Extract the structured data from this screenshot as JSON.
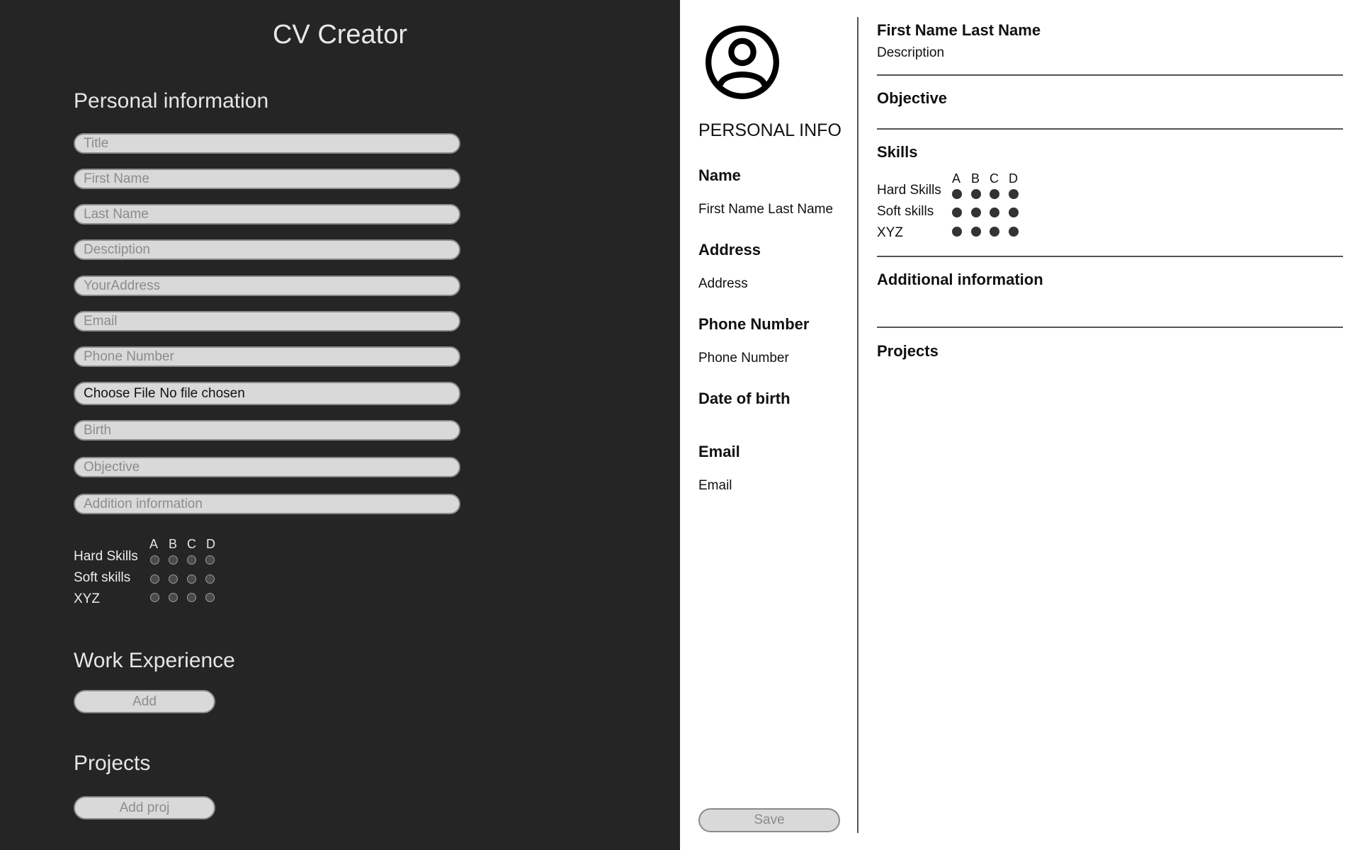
{
  "editor": {
    "app_title": "CV Creator",
    "personal_section_title": "Personal information",
    "fields": {
      "title": "Title",
      "first_name": "First Name",
      "last_name": "Last Name",
      "description": "Desctiption",
      "address": "YourAddress",
      "email": "Email",
      "phone": "Phone Number",
      "birth": "Birth",
      "objective": "Objective",
      "additional": "Addition information"
    },
    "file_input": {
      "button_label": "Choose File",
      "status": "No file chosen"
    },
    "skills": {
      "levels": [
        "A",
        "B",
        "C",
        "D"
      ],
      "rows": [
        "Hard Skills",
        "Soft skills",
        "XYZ"
      ]
    },
    "work_section_title": "Work Experience",
    "work_add_label": "Add",
    "projects_section_title": "Projects",
    "projects_add_label": "Add proj"
  },
  "preview": {
    "sidebar": {
      "heading": "PERSONAL INFO",
      "name_label": "Name",
      "name_value": "First Name Last Name",
      "address_label": "Address",
      "address_value": "Address",
      "phone_label": "Phone Number",
      "phone_value": "Phone Number",
      "dob_label": "Date of birth",
      "email_label": "Email",
      "email_value": "Email",
      "save_label": "Save"
    },
    "main": {
      "full_name": "First Name Last Name",
      "description": "Description",
      "objective_heading": "Objective",
      "skills_heading": "Skills",
      "additional_heading": "Additional information",
      "projects_heading": "Projects"
    },
    "skills": {
      "levels": [
        "A",
        "B",
        "C",
        "D"
      ],
      "rows": [
        "Hard Skills",
        "Soft skills",
        "XYZ"
      ]
    }
  }
}
